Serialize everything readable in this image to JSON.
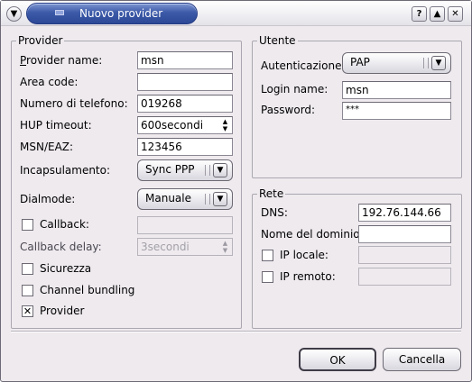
{
  "window": {
    "title": "Nuovo provider",
    "controls": {
      "menu": "▼",
      "help": "?",
      "shade": "▲",
      "close": "✕"
    }
  },
  "provider": {
    "group_label": "Provider",
    "name_label": "Provider name:",
    "name_value": "msn",
    "area_label": "Area code:",
    "area_value": "",
    "phone_label": "Numero di telefono:",
    "phone_value": "019268",
    "hup_label": "HUP timeout:",
    "hup_value": "600secondi",
    "msn_label": "MSN/EAZ:",
    "msn_value": "123456",
    "encap_label": "Incapsulamento:",
    "encap_value": "Sync PPP",
    "dialmode_label": "Dialmode:",
    "dialmode_value": "Manuale",
    "callback_label": "Callback:",
    "callback_checked": false,
    "callback_value": "",
    "callback_delay_label": "Callback delay:",
    "callback_delay_value": "3secondi",
    "security_label": "Sicurezza",
    "security_checked": false,
    "bundling_label": "Channel bundling",
    "bundling_checked": false,
    "provider_label": "Provider",
    "provider_checked": true
  },
  "utente": {
    "group_label": "Utente",
    "auth_label": "Autenticazione:",
    "auth_value": "PAP",
    "login_label": "Login name:",
    "login_value": "msn",
    "password_label": "Password:",
    "password_value": "***"
  },
  "rete": {
    "group_label": "Rete",
    "dns_label": "DNS:",
    "dns_value": "192.76.144.66",
    "domain_label": "Nome del dominio:",
    "domain_value": "",
    "local_ip_label": "IP locale:",
    "local_ip_checked": false,
    "local_ip_value": "",
    "remote_ip_label": "IP remoto:",
    "remote_ip_checked": false,
    "remote_ip_value": ""
  },
  "buttons": {
    "ok": "OK",
    "cancel": "Cancella"
  },
  "icons": {
    "spin": "▲▼",
    "combo_arrow": "▾",
    "checked": "✕"
  }
}
